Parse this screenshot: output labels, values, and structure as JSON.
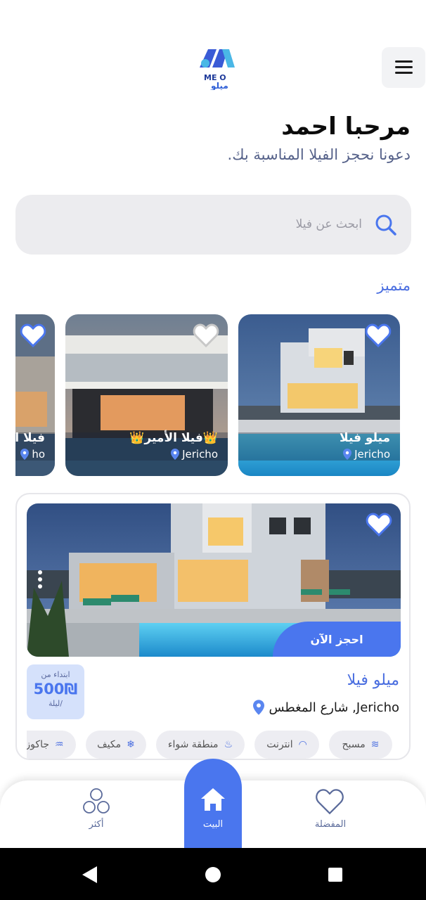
{
  "header": {
    "logo_text_en": "ME O",
    "logo_text_ar": "ميلو"
  },
  "greeting": "مرحبا احمد",
  "subtitle": "دعونا نحجز الفيلا المناسبة بك.",
  "search": {
    "placeholder": "ابحث عن فيلا"
  },
  "featured": {
    "title": "متميز",
    "cards": [
      {
        "name": "ميلو فيلا",
        "location": "Jericho"
      },
      {
        "name": "👑فيلا الأمير👑",
        "location": "Jericho"
      },
      {
        "name": "فيلا ا",
        "location": "ho"
      }
    ]
  },
  "listing": {
    "title": "ميلو فيلا",
    "address": "Jericho, شارع المغطس",
    "book_label": "احجز الآن",
    "price_from": "ابتداء من",
    "price": "500₪",
    "per_night": "/ليلة",
    "amenities": [
      {
        "label": "مسبح",
        "icon": "pool-icon"
      },
      {
        "label": "انترنت",
        "icon": "wifi-icon"
      },
      {
        "label": "منطقة شواء",
        "icon": "grill-icon"
      },
      {
        "label": "مكيف",
        "icon": "snowflake-icon"
      },
      {
        "label": "جاكوزي",
        "icon": "jacuzzi-icon"
      }
    ]
  },
  "nav": {
    "favorites": "المفضلة",
    "home": "البيت",
    "more": "أكثر"
  },
  "colors": {
    "accent": "#4a76ee",
    "heading_blue": "#4a6ee0"
  }
}
